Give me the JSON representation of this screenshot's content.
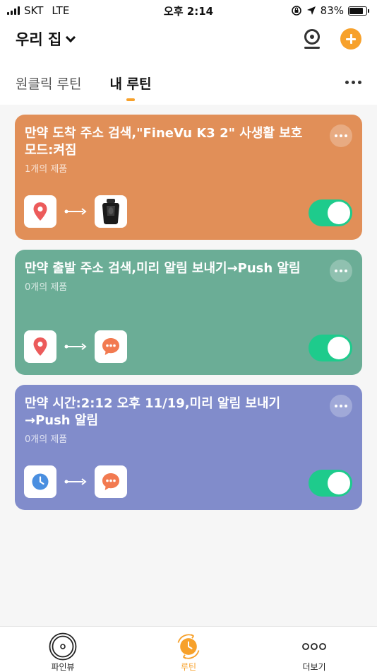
{
  "status_bar": {
    "carrier": "SKT",
    "network": "LTE",
    "time": "오후 2:14",
    "battery": "83%"
  },
  "header": {
    "title": "우리 집"
  },
  "tabs": [
    {
      "label": "원클릭 루틴",
      "active": false
    },
    {
      "label": "내 루틴",
      "active": true
    }
  ],
  "routines": [
    {
      "title": "만약 도착 주소 검색,\"FineVu K3 2\" 사생활 보호 모드:켜짐",
      "subtitle": "1개의 제품",
      "color": "#E18F58",
      "trigger_icon": "location-pin-icon",
      "action_icon": "dashcam-device-icon",
      "enabled": true
    },
    {
      "title": "만약 출발 주소 검색,미리 알림 보내기→Push 알림",
      "subtitle": "0개의 제품",
      "color": "#6BAD96",
      "trigger_icon": "location-pin-icon",
      "action_icon": "chat-bubble-icon",
      "enabled": true
    },
    {
      "title": "만약 시간:2:12 오후 11/19,미리 알림 보내기 →Push 알림",
      "subtitle": "0개의 제품",
      "color": "#818CCB",
      "trigger_icon": "clock-icon",
      "action_icon": "chat-bubble-icon",
      "enabled": true
    }
  ],
  "bottom_nav": [
    {
      "label": "파인뷰",
      "icon": "finevu-logo-icon",
      "active": false
    },
    {
      "label": "루틴",
      "icon": "routine-icon",
      "active": true
    },
    {
      "label": "더보기",
      "icon": "more-icon",
      "active": false
    }
  ],
  "colors": {
    "accent": "#F7A12B",
    "toggle_on": "#1ECB8C"
  }
}
